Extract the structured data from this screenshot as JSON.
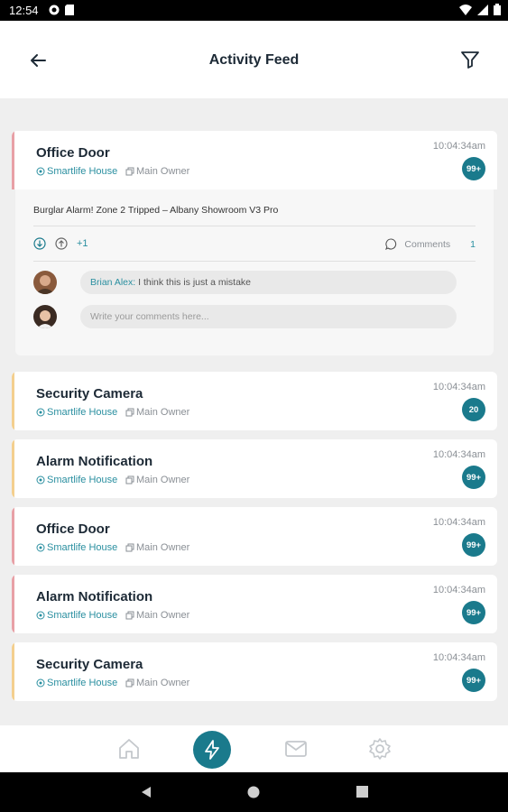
{
  "status_bar": {
    "time": "12:54"
  },
  "header": {
    "title": "Activity Feed"
  },
  "feed": [
    {
      "name": "Office Door",
      "location": "Smartlife House",
      "owner": "Main Owner",
      "time": "10:04:34am",
      "badge": "99+",
      "accent": "#e8a0a6"
    },
    {
      "name": "Security Camera",
      "location": "Smartlife House",
      "owner": "Main Owner",
      "time": "10:04:34am",
      "badge": "20",
      "accent": "#f4cf8e"
    },
    {
      "name": "Alarm Notification",
      "location": "Smartlife House",
      "owner": "Main Owner",
      "time": "10:04:34am",
      "badge": "99+",
      "accent": "#f4cf8e"
    },
    {
      "name": "Office Door",
      "location": "Smartlife House",
      "owner": "Main Owner",
      "time": "10:04:34am",
      "badge": "99+",
      "accent": "#e8a0a6"
    },
    {
      "name": "Alarm Notification",
      "location": "Smartlife House",
      "owner": "Main Owner",
      "time": "10:04:34am",
      "badge": "99+",
      "accent": "#e8a0a6"
    },
    {
      "name": "Security Camera",
      "location": "Smartlife House",
      "owner": "Main Owner",
      "time": "10:04:34am",
      "badge": "99+",
      "accent": "#f4cf8e"
    }
  ],
  "expanded": {
    "message": "Burglar Alarm! Zone 2 Tripped – Albany Showroom V3 Pro",
    "extra_count": "+1",
    "comments_label": "Comments",
    "comments_count": "1",
    "comment": {
      "author": "Brian Alex:",
      "text": "I think this is just a mistake"
    },
    "input_placeholder": "Write your comments here..."
  },
  "bottom_nav": [
    {
      "icon": "home-icon",
      "active": false
    },
    {
      "icon": "activity-icon",
      "active": true
    },
    {
      "icon": "mail-icon",
      "active": false
    },
    {
      "icon": "settings-icon",
      "active": false
    }
  ],
  "colors": {
    "brand": "#1a7a8c",
    "link": "#2a8fa0",
    "accent_red": "#e8a0a6",
    "accent_yellow": "#f4cf8e"
  }
}
